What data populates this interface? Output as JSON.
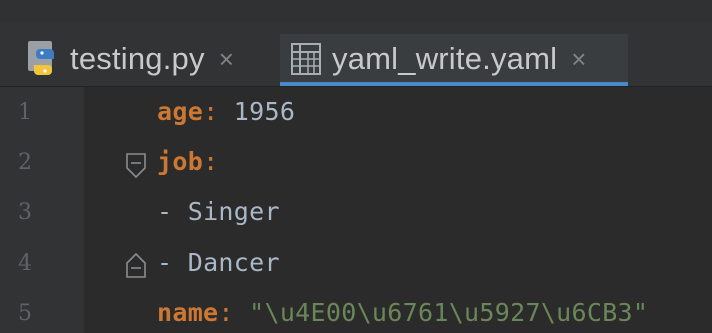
{
  "tabs": [
    {
      "label": "testing.py",
      "close": "×",
      "icon": "python-file-icon",
      "active": false
    },
    {
      "label": "yaml_write.yaml",
      "close": "×",
      "icon": "yaml-file-icon",
      "active": true
    }
  ],
  "editor": {
    "lines": [
      {
        "number": "1",
        "key": "age",
        "sep": ":",
        "value": "1956"
      },
      {
        "number": "2",
        "key": "job",
        "sep": ":",
        "value": ""
      },
      {
        "number": "3",
        "dash": "-",
        "value": "Singer"
      },
      {
        "number": "4",
        "dash": "-",
        "value": "Dancer"
      },
      {
        "number": "5",
        "key": "name",
        "sep": ":",
        "value": "\"\\u4E00\\u6761\\u5927\\u6CB3\""
      }
    ]
  },
  "colors": {
    "background": "#2b2b2b",
    "gutter": "#313335",
    "key": "#cc7832",
    "string": "#6a8759",
    "text": "#a9b7c6",
    "tab_underline": "#4a88c7"
  }
}
